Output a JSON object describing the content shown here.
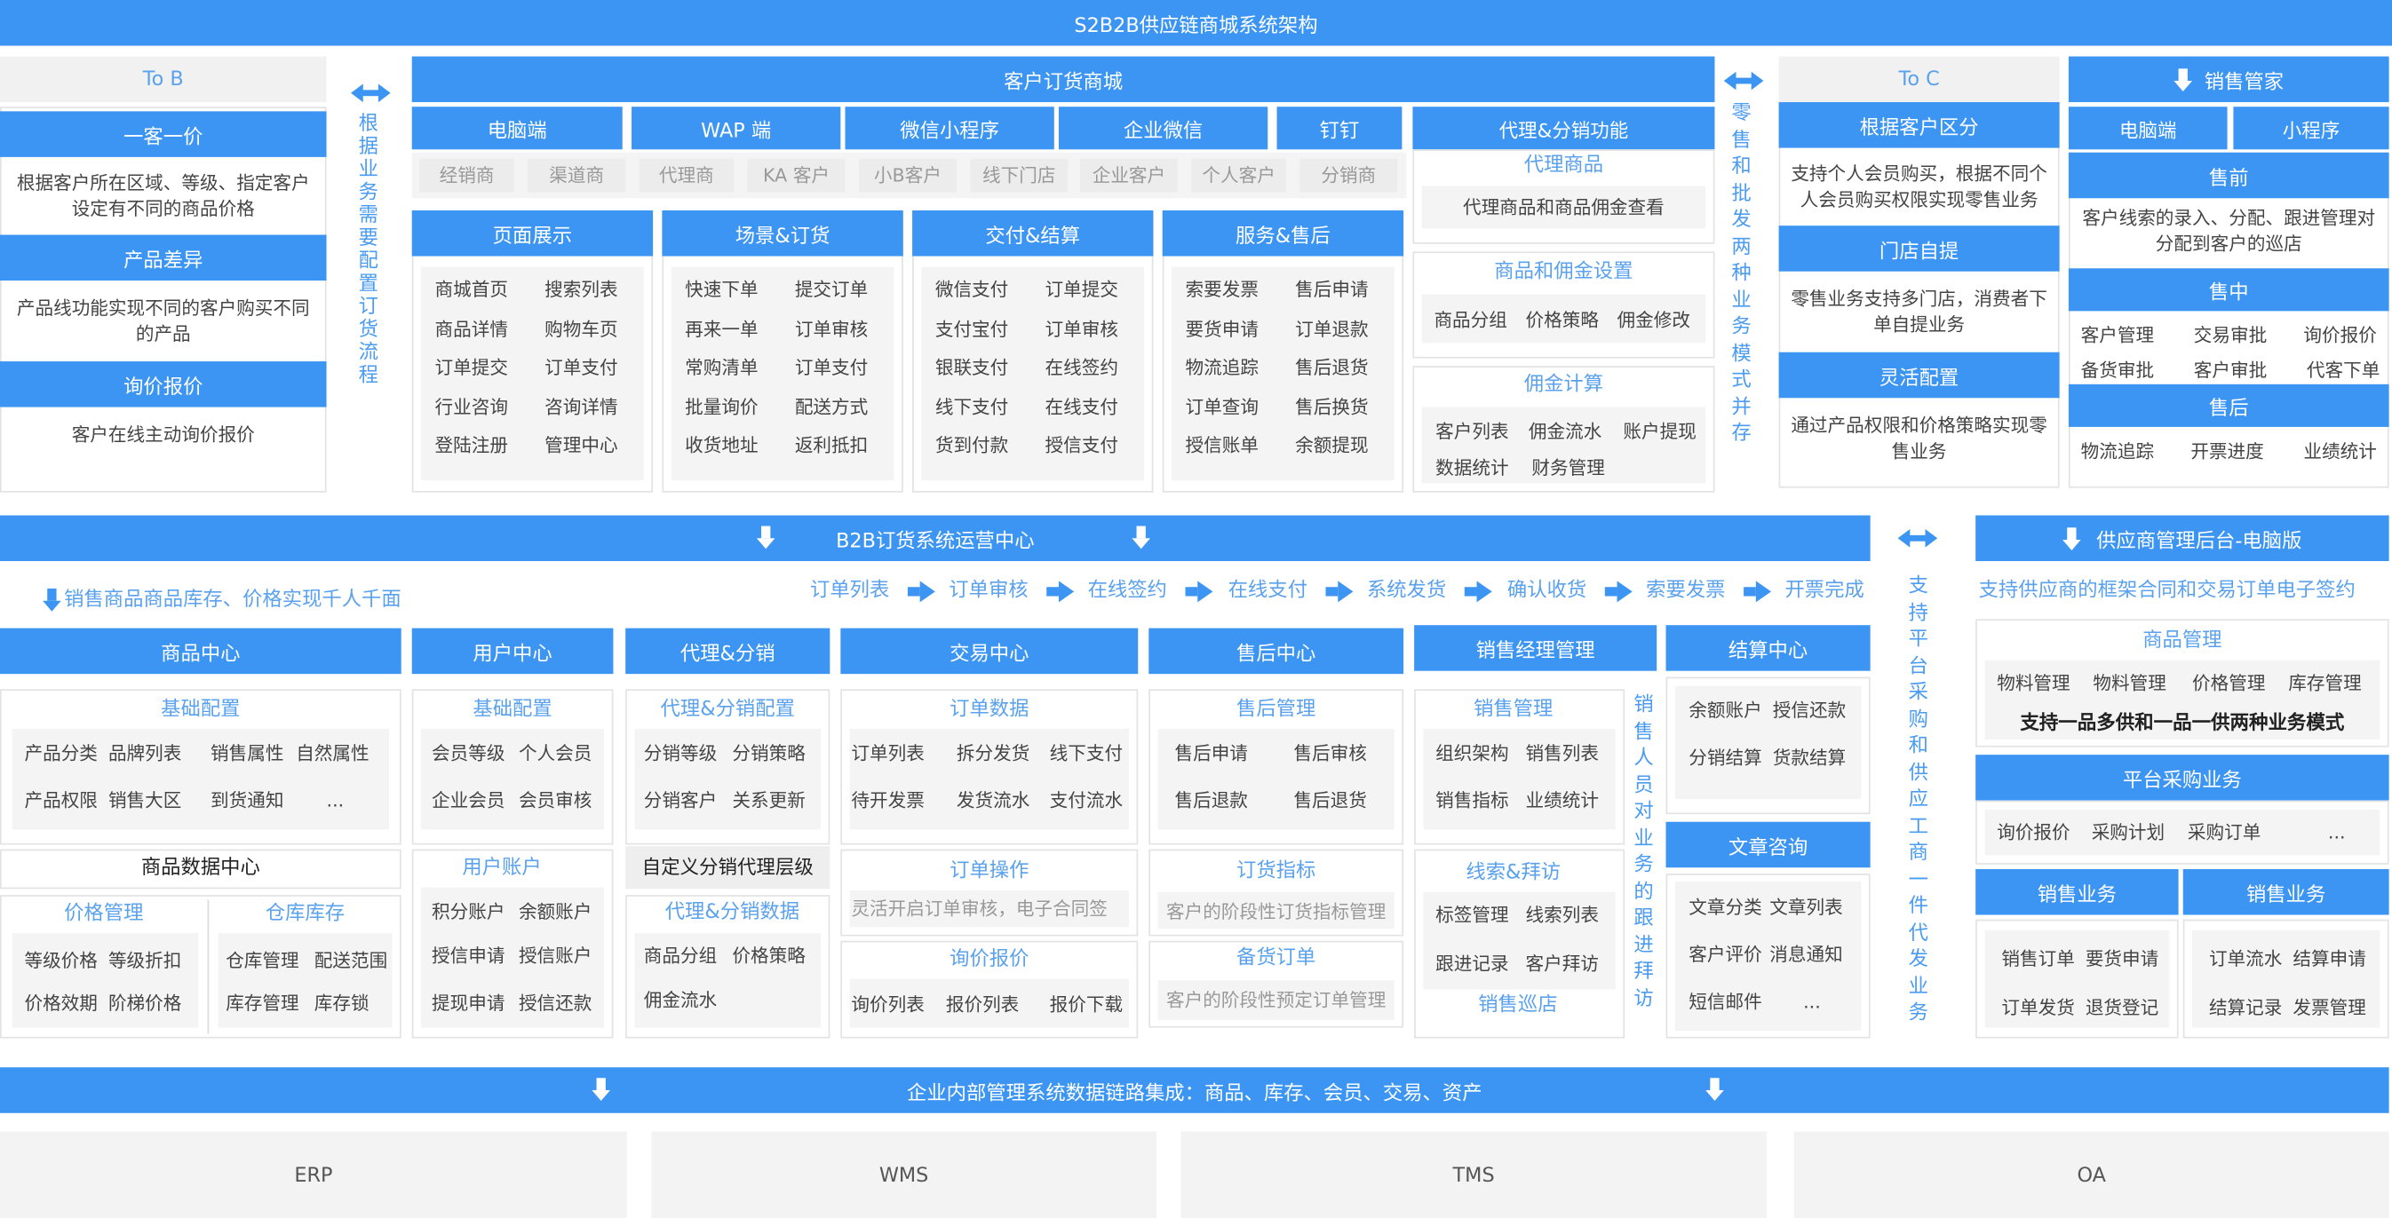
{
  "title": "S2B2B供应链商城系统架构",
  "tob": {
    "head": "To B",
    "h1": "一客一价",
    "d1": "根据客户所在区域、等级、指定客户设定有不同的商品价格",
    "h2": "产品差异",
    "d2": "产品线功能实现不同的客户购买不同的产品",
    "h3": "询价报价",
    "d3": "客户在线主动询价报价"
  },
  "vert_left": "根据业务需要配置订货流程",
  "mall": {
    "head": "客户订货商城",
    "tabs": [
      "电脑端",
      "WAP 端",
      "微信小程序",
      "企业微信",
      "钉钉"
    ],
    "customers": [
      "经销商",
      "渠道商",
      "代理商",
      "KA 客户",
      "小B客户",
      "线下门店",
      "企业客户",
      "个人客户",
      "分销商"
    ],
    "c1": {
      "head": "页面展示",
      "items": [
        "商城首页",
        "搜索列表",
        "商品详情",
        "购物车页",
        "订单提交",
        "订单支付",
        "行业咨询",
        "咨询详情",
        "登陆注册",
        "管理中心"
      ]
    },
    "c2": {
      "head": "场景&订货",
      "items": [
        "快速下单",
        "提交订单",
        "再来一单",
        "订单审核",
        "常购清单",
        "订单支付",
        "批量询价",
        "配送方式",
        "收货地址",
        "返利抵扣"
      ]
    },
    "c3": {
      "head": "交付&结算",
      "items": [
        "微信支付",
        "订单提交",
        "支付宝付",
        "订单审核",
        "银联支付",
        "在线签约",
        "线下支付",
        "在线支付",
        "货到付款",
        "授信支付"
      ]
    },
    "c4": {
      "head": "服务&售后",
      "items": [
        "索要发票",
        "售后申请",
        "要货申请",
        "订单退款",
        "物流追踪",
        "售后退货",
        "订单查询",
        "售后换货",
        "授信账单",
        "余额提现"
      ]
    }
  },
  "agent": {
    "head": "代理&分销功能",
    "s1": "代理商品",
    "s1d": "代理商品和商品佣金查看",
    "s2": "商品和佣金设置",
    "s2items": [
      "商品分组",
      "价格策略",
      "佣金修改"
    ],
    "s3": "佣金计算",
    "s3items": [
      "客户列表",
      "佣金流水",
      "账户提现",
      "数据统计",
      "财务管理"
    ]
  },
  "vert_mid": "零售和批发两种业务模式并存",
  "toc": {
    "head": "To C",
    "h1": "根据客户区分",
    "d1": "支持个人会员购买，根据不同个人会员购买权限实现零售业务",
    "h2": "门店自提",
    "d2": "零售业务支持多门店，消费者下单自提业务",
    "h3": "灵活配置",
    "d3": "通过产品权限和价格策略实现零售业务"
  },
  "sales": {
    "head": "销售管家",
    "tabs": [
      "电脑端",
      "小程序"
    ],
    "h1": "售前",
    "d1": "客户线索的录入、分配、跟进管理对分配到客户的巡店",
    "h2": "售中",
    "items2": [
      "客户管理",
      "交易审批",
      "询价报价",
      "备货审批",
      "客户审批",
      "代客下单"
    ],
    "h3": "售后",
    "items3": [
      "物流追踪",
      "开票进度",
      "业绩统计"
    ]
  },
  "ops": {
    "head": "B2B订货系统运营中心",
    "note": "销售商品商品库存、价格实现千人千面",
    "flow": [
      "订单列表",
      "订单审核",
      "在线签约",
      "在线支付",
      "系统发货",
      "确认收货",
      "索要发票",
      "开票完成"
    ]
  },
  "goods": {
    "head": "商品中心",
    "base": "基础配置",
    "items": [
      "产品分类",
      "品牌列表",
      "销售属性",
      "自然属性",
      "产品权限",
      "销售大区",
      "到货通知",
      "..."
    ],
    "center": "商品数据中心",
    "price": "价格管理",
    "priceItems": [
      "等级价格",
      "等级折扣",
      "价格效期",
      "阶梯价格"
    ],
    "stock": "仓库库存",
    "stockItems": [
      "仓库管理",
      "配送范围",
      "库存管理",
      "库存锁"
    ]
  },
  "user": {
    "head": "用户中心",
    "base": "基础配置",
    "items": [
      "会员等级",
      "个人会员",
      "企业会员",
      "会员审核"
    ],
    "acct": "用户账户",
    "acctItems": [
      "积分账户",
      "余额账户",
      "授信申请",
      "授信账户",
      "提现申请",
      "授信还款"
    ]
  },
  "dist": {
    "head": "代理&分销",
    "cfg": "代理&分销配置",
    "items": [
      "分销等级",
      "分销策略",
      "分销客户",
      "关系更新"
    ],
    "custom": "自定义分销代理层级",
    "data": "代理&分销数据",
    "dataItems": [
      "商品分组",
      "价格策略",
      "佣金流水"
    ]
  },
  "trade": {
    "head": "交易中心",
    "s1": "订单数据",
    "items": [
      "订单列表",
      "拆分发货",
      "线下支付",
      "待开发票",
      "发货流水",
      "支付流水"
    ],
    "s2": "订单操作",
    "s2d": "灵活开启订单审核，电子合同签",
    "s3": "询价报价",
    "s3items": [
      "询价列表",
      "报价列表",
      "报价下载"
    ]
  },
  "after": {
    "head": "售后中心",
    "s1": "售后管理",
    "items": [
      "售后申请",
      "售后审核",
      "售后退款",
      "售后退货"
    ],
    "s2": "订货指标",
    "s2d": "客户的阶段性订货指标管理",
    "s3": "备货订单",
    "s3d": "客户的阶段性预定订单管理"
  },
  "mgr": {
    "head": "销售经理管理",
    "s1": "销售管理",
    "items": [
      "组织架构",
      "销售列表",
      "销售指标",
      "业绩统计"
    ],
    "s2": "线索&拜访",
    "s2items": [
      "标签管理",
      "线索列表",
      "跟进记录",
      "客户拜访"
    ],
    "s3": "销售巡店"
  },
  "vert_sales": "销售人员对业务的跟进拜访",
  "settle": {
    "head": "结算中心",
    "items": [
      "余额账户",
      "授信还款",
      "分销结算",
      "货款结算"
    ],
    "head2": "文章咨询",
    "items2": [
      "文章分类",
      "文章列表",
      "客户评价",
      "消息通知",
      "短信邮件",
      "..."
    ]
  },
  "vert_right": "支持平台采购和供应工商一件代发业务",
  "supplier": {
    "head": "供应商管理后台-电脑版",
    "note": "支持供应商的框架合同和交易订单电子签约",
    "s1": "商品管理",
    "s1items": [
      "物料管理",
      "物料管理",
      "价格管理",
      "库存管理"
    ],
    "s1bold": "支持一品多供和一品一供两种业务模式",
    "s2": "平台采购业务",
    "s2items": [
      "询价报价",
      "采购计划",
      "采购订单",
      "..."
    ],
    "s3": "销售业务",
    "s3items": [
      "销售订单",
      "要货申请",
      "订单发货",
      "退货登记"
    ],
    "s4": "销售业务",
    "s4items": [
      "订单流水",
      "结算申请",
      "结算记录",
      "发票管理"
    ]
  },
  "bar": "企业内部管理系统数据链路集成：商品、库存、会员、交易、资产",
  "systems": [
    "ERP",
    "WMS",
    "TMS",
    "OA"
  ]
}
